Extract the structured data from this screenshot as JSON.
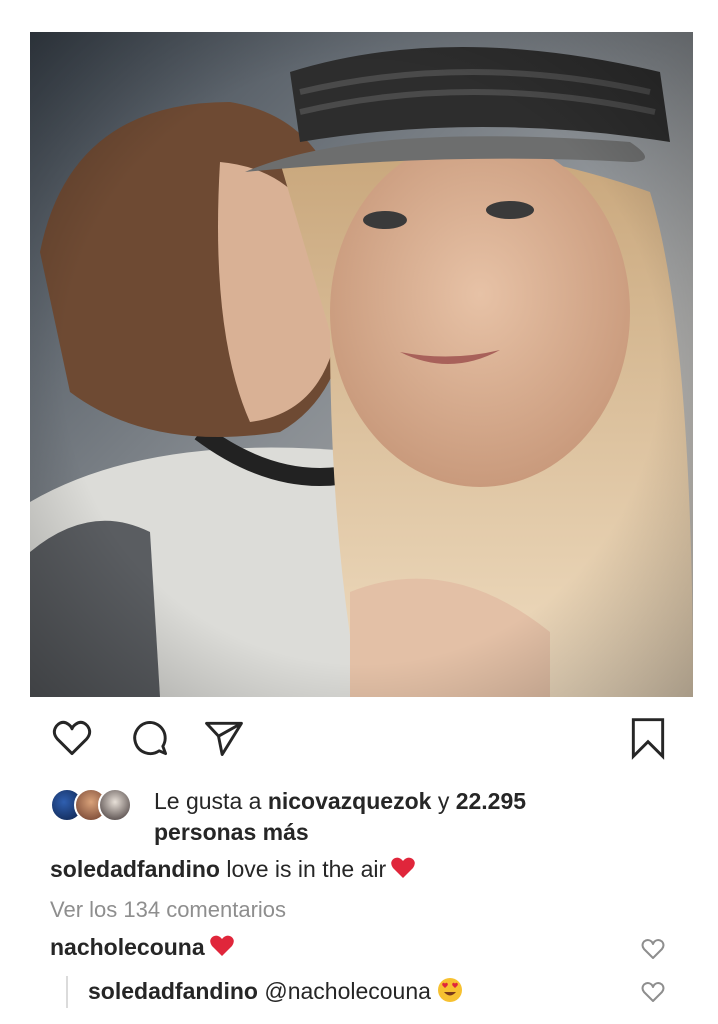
{
  "post": {
    "likes": {
      "prefix": "Le gusta a",
      "user": "nicovazquezok",
      "connector": "y",
      "count": "22.295",
      "suffix": "personas más"
    },
    "caption": {
      "username": "soledadfandino",
      "text": "love is in the air"
    },
    "view_comments_label": "Ver los 134 comentarios",
    "comments": [
      {
        "username": "nacholecouna",
        "text": ""
      },
      {
        "username": "soledadfandino",
        "text": "@nacholecouna"
      }
    ]
  },
  "icons": {
    "like": "heart-outline-icon",
    "comment": "speech-bubble-icon",
    "share": "paper-plane-icon",
    "save": "bookmark-icon"
  },
  "colors": {
    "text": "#262626",
    "muted": "#8e8e8e",
    "heart_red": "#e0263b"
  }
}
